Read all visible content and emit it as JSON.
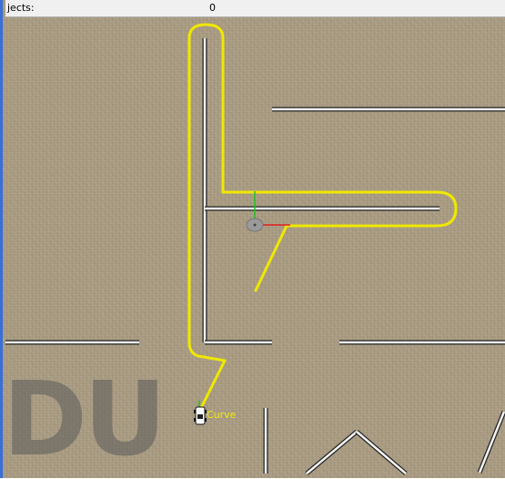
{
  "hud": {
    "label": "jects:",
    "value": "0"
  },
  "scene": {
    "watermark": "DU",
    "curve_label": "Curve",
    "colors": {
      "path": "#f0e800",
      "wall": "#f4f4f4",
      "wall_edge": "#222222",
      "axis_x": "#e02020",
      "axis_y": "#20c020"
    },
    "icons": [
      "gizmo-sphere-icon",
      "car-icon"
    ]
  }
}
